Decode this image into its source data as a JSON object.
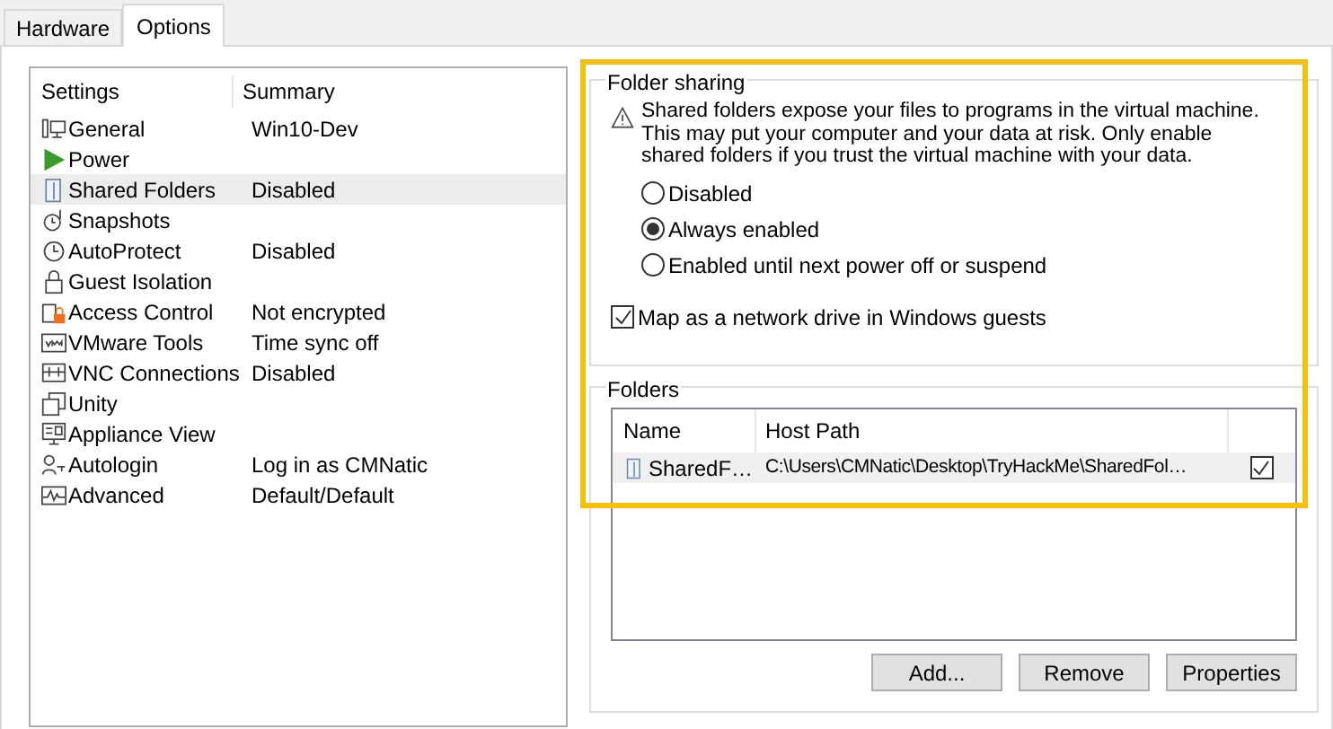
{
  "tabs": [
    {
      "label": "Hardware",
      "selected": false
    },
    {
      "label": "Options",
      "selected": true
    }
  ],
  "settings": {
    "columns": [
      "Settings",
      "Summary"
    ],
    "rows": [
      {
        "name": "General",
        "summary": "Win10-Dev",
        "selected": false
      },
      {
        "name": "Power",
        "selected": false
      },
      {
        "name": "Shared Folders",
        "summary": "Disabled",
        "selected": true
      },
      {
        "name": "Snapshots",
        "selected": false
      },
      {
        "name": "AutoProtect",
        "summary": "Disabled",
        "selected": false
      },
      {
        "name": "Guest Isolation",
        "selected": false
      },
      {
        "name": "Access Control",
        "summary": "Not encrypted",
        "selected": false
      },
      {
        "name": "VMware Tools",
        "summary": "Time sync off",
        "selected": false
      },
      {
        "name": "VNC Connections",
        "summary": "Disabled",
        "selected": false
      },
      {
        "name": "Unity",
        "selected": false
      },
      {
        "name": "Appliance View",
        "selected": false
      },
      {
        "name": "Autologin",
        "summary": "Log in as CMNatic",
        "selected": false
      },
      {
        "name": "Advanced",
        "summary": "Default/Default",
        "selected": false
      }
    ]
  },
  "folder_sharing": {
    "title": "Folder sharing",
    "warning": "Shared folders expose your files to programs in the virtual machine. This may put your computer and your data at risk. Only enable shared folders if you trust the virtual machine with your data.",
    "options": [
      {
        "label": "Disabled",
        "selected": false
      },
      {
        "label": "Always enabled",
        "selected": true
      },
      {
        "label": "Enabled until next power off or suspend",
        "selected": false
      }
    ],
    "map_drive": {
      "label": "Map as a network drive in Windows guests",
      "checked": true
    }
  },
  "folders": {
    "title": "Folders",
    "columns": [
      "Name",
      "Host Path"
    ],
    "rows": [
      {
        "name": "SharedF…",
        "host_path": "C:\\Users\\CMNatic\\Desktop\\TryHackMe\\SharedFol…",
        "enabled": true
      }
    ],
    "buttons": [
      "Add...",
      "Remove",
      "Properties"
    ]
  }
}
